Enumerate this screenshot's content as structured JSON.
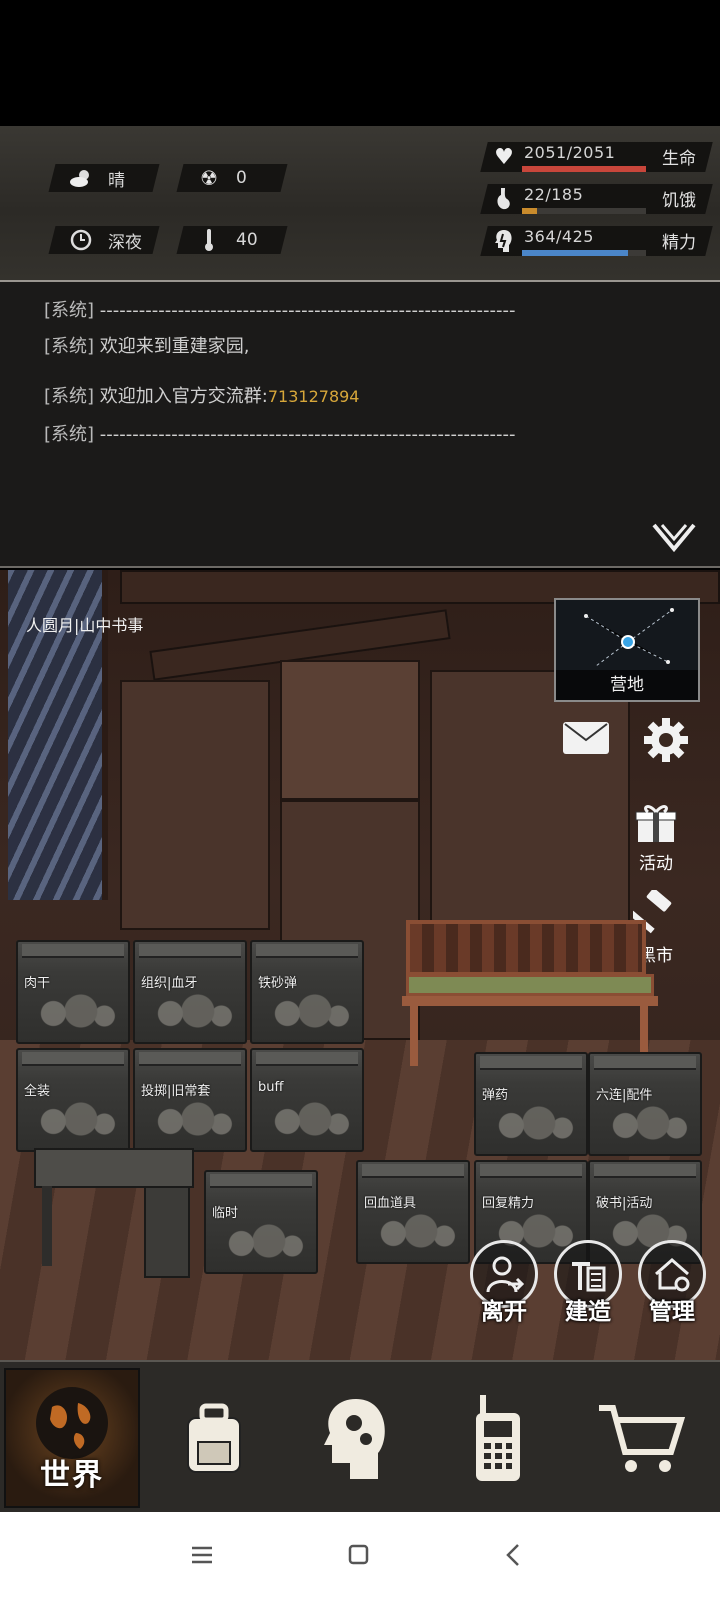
{
  "status": {
    "weather": {
      "icon": "cloud-sun-icon",
      "value": "晴"
    },
    "radiation": {
      "icon": "radiation-icon",
      "value": "0"
    },
    "time": {
      "icon": "clock-icon",
      "value": "深夜"
    },
    "temperature": {
      "icon": "thermometer-icon",
      "value": "40"
    },
    "health": {
      "value": "2051/2051",
      "label": "生命",
      "fraction": 1.0,
      "color": "#c8463b"
    },
    "hunger": {
      "value": "22/185",
      "label": "饥饿",
      "fraction": 0.119,
      "color": "#c98b2c"
    },
    "energy": {
      "value": "364/425",
      "label": "精力",
      "fraction": 0.856,
      "color": "#4b86c9"
    }
  },
  "log": {
    "lines": [
      {
        "tag": "[系统]",
        "text": "----------------------------------------------------------------",
        "highlight": ""
      },
      {
        "tag": "[系统]",
        "text": "欢迎来到重建家园,",
        "highlight": ""
      },
      {
        "tag": "[系统]",
        "text": " 欢迎加入官方交流群:",
        "highlight": "713127894"
      },
      {
        "tag": "[系统]",
        "text": "----------------------------------------------------------------",
        "highlight": ""
      }
    ]
  },
  "scene": {
    "title": "人圆月|山中书事",
    "minimap_label": "营地",
    "side": {
      "activity": "活动",
      "black_market": "黑市"
    },
    "crates": [
      {
        "label": "肉干"
      },
      {
        "label": "组织|血牙"
      },
      {
        "label": "铁砂弹"
      },
      {
        "label": "全装"
      },
      {
        "label": "投掷|旧常套"
      },
      {
        "label": "buff"
      },
      {
        "label": "弹药"
      },
      {
        "label": "六连|配件"
      },
      {
        "label": "临时"
      },
      {
        "label": "回血道具"
      },
      {
        "label": "回复精力"
      },
      {
        "label": "破书|活动"
      }
    ],
    "actions": {
      "leave": "离开",
      "build": "建造",
      "manage": "管理"
    }
  },
  "nav": {
    "world": "世界",
    "items": [
      "world-icon",
      "backpack-icon",
      "skills-head-icon",
      "radio-icon",
      "cart-icon"
    ]
  }
}
